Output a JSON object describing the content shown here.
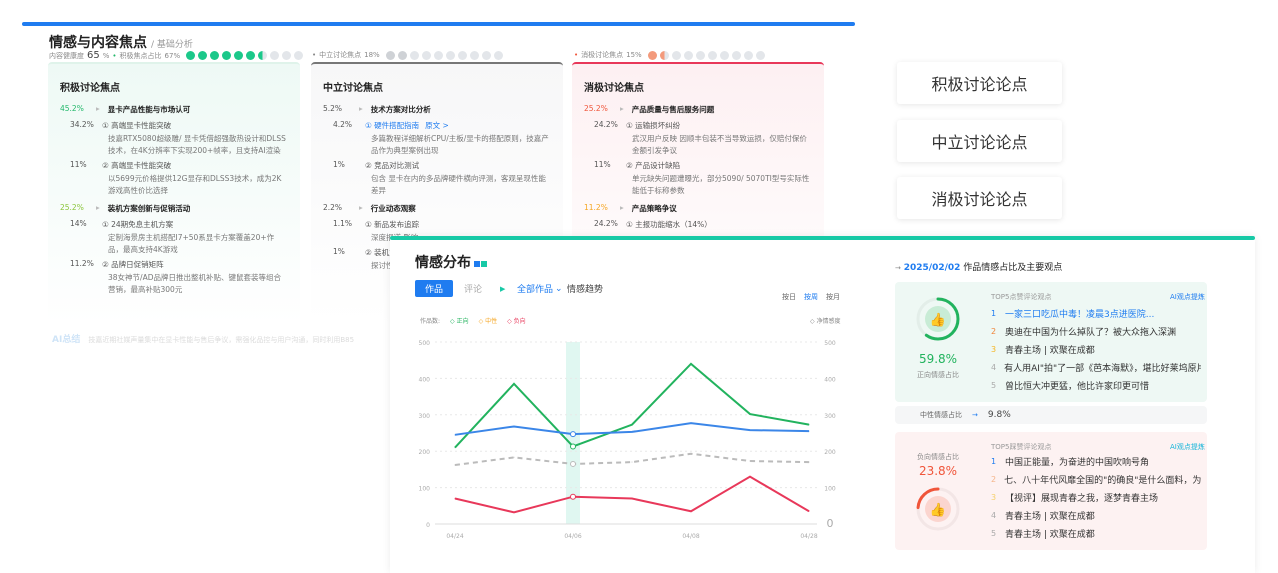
{
  "back": {
    "title": "情感与内容焦点",
    "subtitle": "/ 基础分析",
    "health_label": "内容健康度",
    "health_value": "65",
    "health_unit": "%",
    "pos_label": "积极焦点占比",
    "pos_value": "67%",
    "neu_label": "中立讨论焦点",
    "neu_value": "18%",
    "neg_label": "消极讨论焦点",
    "neg_value": "15%",
    "columns": [
      {
        "title": "积极讨论焦点",
        "color": "#22b86a",
        "sections": [
          {
            "pct": "45.2%",
            "title": "显卡产品性能与市场认可",
            "items": [
              {
                "pct": "34.2%",
                "title": "① 高端显卡性能突破",
                "desc": "技嘉RTX5080超级雕/ 显卡凭借超强散热设计和DLSS技术，在4K分辨率下实现200+帧率，且支持AI渲染"
              },
              {
                "pct": "11%",
                "title": "② 高端显卡性能突破",
                "desc": "以5699元价格提供12G显存和DLSS3技术，成为2K游戏高性价比选择"
              }
            ]
          },
          {
            "pct": "25.2%",
            "title": "装机方案创新与促销活动",
            "items": [
              {
                "pct": "14%",
                "title": "① 24期免息主机方案",
                "desc": "定制海景房主机搭配I7+50系显卡方案覆盖20+作品，最高支持4K游戏"
              },
              {
                "pct": "11.2%",
                "title": "② 品牌日促销矩阵",
                "desc": "38女神节/AD品牌日推出整机补贴、键鼠套装等组合营销，最高补贴300元"
              }
            ]
          }
        ]
      },
      {
        "title": "中立讨论焦点",
        "color": "#555",
        "sections": [
          {
            "pct": "5.2%",
            "title": "技术方案对比分析",
            "items": [
              {
                "pct": "4.2%",
                "title": "① 硬件搭配指南",
                "link": "原文 >",
                "desc": "多篇教程详细解析CPU/主板/显卡的搭配原则，技嘉产品作为典型案例出现"
              },
              {
                "pct": "1%",
                "title": "② 竞品对比测试",
                "desc": "包含 显卡在内的多品牌硬件横向评测，客观呈现性能差异"
              }
            ]
          },
          {
            "pct": "2.2%",
            "title": "行业动态观察",
            "items": [
              {
                "pct": "1.1%",
                "title": "① 新品发布追踪",
                "desc": "深度报道 影响"
              },
              {
                "pct": "1%",
                "title": "② 装机方",
                "desc": "探讨性价"
              }
            ]
          }
        ]
      },
      {
        "title": "消极讨论焦点",
        "color": "#f0553a",
        "sections": [
          {
            "pct": "25.2%",
            "title": "产品质量与售后服务问题",
            "items": [
              {
                "pct": "24.2%",
                "title": "① 运输损坏纠纷",
                "desc": "武汉用户反映 因顺丰包装不当导致运损，仅赔付保价金额引发争议"
              },
              {
                "pct": "11%",
                "title": "② 产品设计缺陷",
                "desc": "单元缺失问题遭曝光，部分5090/ 5070TI型号实际性能低于标称参数"
              }
            ]
          },
          {
            "pct": "11.2%",
            "title": "产品策略争议",
            "items": [
              {
                "pct": "24.2%",
                "title": "① 主报功能缩水（14%）",
                "desc": ""
              }
            ]
          }
        ]
      }
    ],
    "ai_summary_label": "AI总结",
    "ai_summary_text": "技嘉近期社媒声量集中在显卡性能与售后争议，需强化品控与用户沟通，同时利用B85"
  },
  "tags": [
    "积极讨论论点",
    "中立讨论论点",
    "消极讨论论点"
  ],
  "front": {
    "title": "情感分布",
    "tabs": [
      "作品",
      "评论"
    ],
    "filter": "全部作品",
    "trend_label": "情感趋势",
    "periods": [
      "按日",
      "按周",
      "按月"
    ],
    "active_period": "按周",
    "legend_prefix": "作品数:",
    "net_label": "净情感度",
    "date": "2025/02/02",
    "date_suffix": "作品情感占比及主要观点",
    "positive": {
      "pct": "59.8%",
      "label": "正向情感占比",
      "list_title": "TOP5点赞评论观点",
      "ai": "AI观点提炼",
      "items": [
        "一家三口吃瓜中毒！凌晨3点进医院...",
        "奥迪在中国为什么掉队了？被大众拖入深渊",
        "青春主场 | 欢聚在成都",
        "有人用AI\"拍\"了一部《芭本海默》，堪比好莱坞原片",
        "曾比恒大冲更猛，他比许家印更可惜"
      ]
    },
    "neutral": {
      "label": "中性情感占比",
      "pct": "9.8%"
    },
    "negative": {
      "pct": "23.8%",
      "label": "负向情感占比",
      "list_title": "TOP5踩赞评论观点",
      "ai": "AI观点提炼",
      "items": [
        "中国正能量，为奋进的中国吹响号角",
        "七、八十年代风靡全国的\"的确良\"是什么面料，为何相...",
        "【视评】展现青春之我，逐梦青春主场",
        "青春主场 | 欢聚在成都",
        "青春主场 | 欢聚在成都"
      ]
    }
  },
  "chart_data": {
    "type": "line",
    "x": [
      "04/24",
      "",
      "04/06",
      "",
      "04/08",
      "",
      "04/28"
    ],
    "x_tick_labels": [
      "04/24",
      "04/06",
      "04/08",
      "04/28"
    ],
    "ylim": [
      0,
      500
    ],
    "y_ticks": [
      0,
      100,
      200,
      300,
      400,
      500
    ],
    "y2_ticks": [
      "0",
      "100",
      "200",
      "300",
      "400",
      "500"
    ],
    "grid": true,
    "highlight": "04/06",
    "series": [
      {
        "name": "正向",
        "color": "#22b35e",
        "values": [
          210,
          385,
          213,
          273,
          440,
          302,
          273
        ]
      },
      {
        "name": "中性",
        "color": "#f5a623",
        "values": [
          245,
          268,
          247,
          253,
          277,
          258,
          255
        ]
      },
      {
        "name": "负向",
        "color": "#e8385a",
        "values": [
          70,
          32,
          75,
          70,
          35,
          130,
          35
        ]
      },
      {
        "name": "净情感度",
        "color": "#bbbbbb",
        "dashed": true,
        "values": [
          162,
          183,
          165,
          170,
          193,
          173,
          170
        ]
      }
    ],
    "line_colors": {
      "中性": "#3b86e8"
    }
  }
}
